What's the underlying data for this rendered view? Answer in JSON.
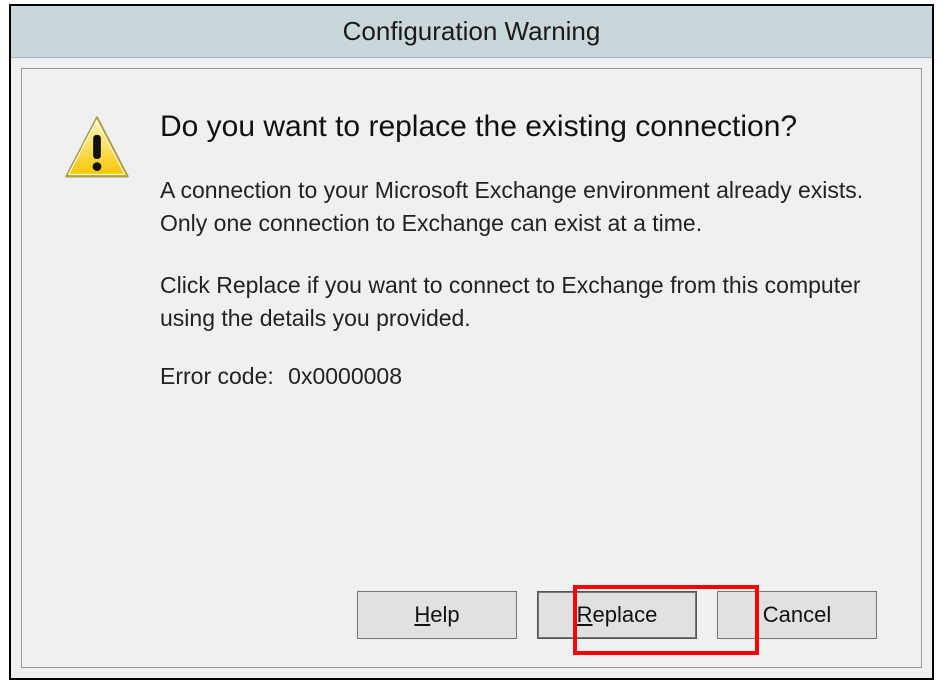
{
  "window": {
    "title": "Configuration Warning"
  },
  "icon": {
    "name": "warning-icon"
  },
  "dialog": {
    "heading": "Do you want to replace the existing connection?",
    "paragraph1": "A connection to your Microsoft Exchange environment already exists. Only one connection to Exchange can exist at a time.",
    "paragraph2": "Click Replace if you want to connect to Exchange from this computer using the details you provided.",
    "error_label": "Error code:",
    "error_code": "0x0000008"
  },
  "buttons": {
    "help": "Help",
    "replace": "Replace",
    "cancel": "Cancel"
  }
}
